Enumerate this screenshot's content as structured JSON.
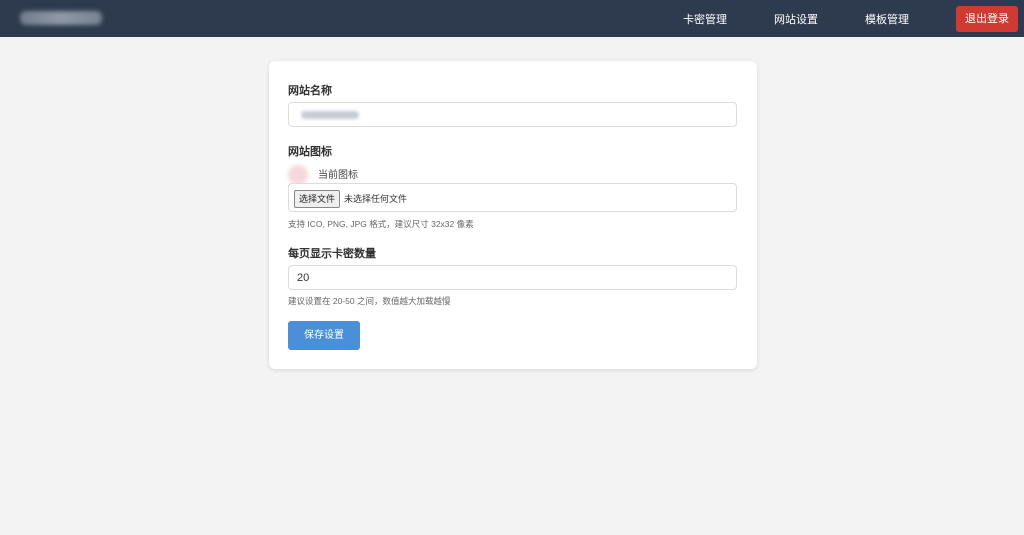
{
  "navbar": {
    "links": [
      "卡密管理",
      "网站设置",
      "模板管理"
    ],
    "logout_label": "退出登录",
    "bg_color": "#2e3b4e",
    "logout_color": "#cf3b33"
  },
  "form": {
    "site_name": {
      "label": "网站名称"
    },
    "site_icon": {
      "label": "网站图标",
      "current_label": "当前图标",
      "file_button": "选择文件",
      "file_status": "未选择任何文件",
      "hint": "支持 ICO, PNG, JPG 格式，建议尺寸 32x32 像素"
    },
    "per_page": {
      "label": "每页显示卡密数量",
      "value": "20",
      "hint": "建议设置在 20-50 之间，数值越大加载越慢"
    },
    "save_label": "保存设置",
    "save_color": "#4a90d9"
  }
}
